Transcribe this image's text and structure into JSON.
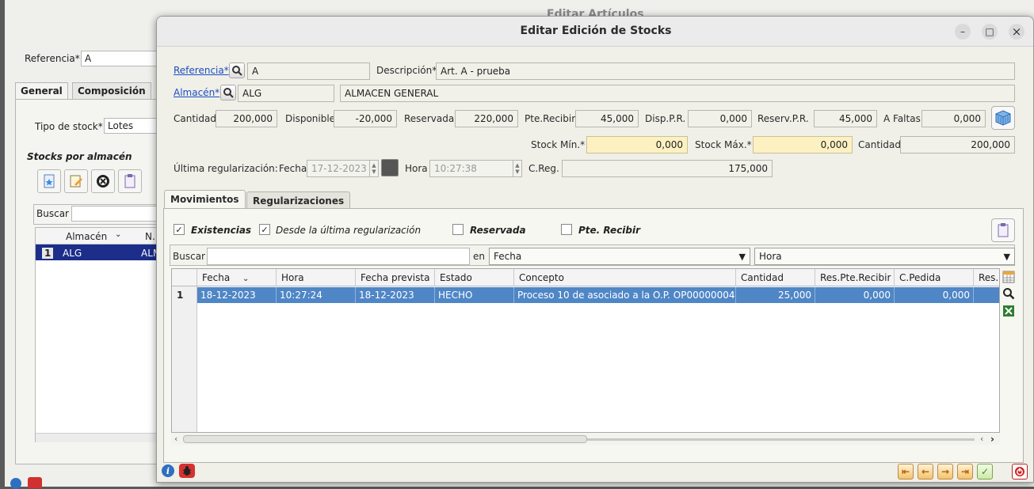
{
  "background_window": {
    "title": "Editar Artículos",
    "referencia_label": "Referencia*",
    "referencia_value": "A",
    "tabs": [
      {
        "label": "General",
        "accel": "G"
      },
      {
        "label": "Composición",
        "accel": "m"
      }
    ],
    "tipo_stock_label": "Tipo de stock*",
    "tipo_stock_value": "Lotes",
    "stocks_section": "Stocks por almacén",
    "buscar_label": "Buscar",
    "grid_headers": [
      "Almacén",
      "N."
    ],
    "grid_row": {
      "num": "1",
      "almacen": "ALG",
      "n": "ALM"
    }
  },
  "dialog": {
    "title": "Editar Edición de Stocks",
    "controls": {
      "minimize": "–",
      "maximize": "□",
      "close": "×"
    },
    "referencia": {
      "label": "Referencia*",
      "value": "A"
    },
    "descripcion": {
      "label": "Descripción*",
      "value": "Art. A - prueba"
    },
    "almacen": {
      "label": "Almacén*",
      "code": "ALG",
      "name": "ALMACEN GENERAL"
    },
    "quantities": {
      "cantidad": {
        "label": "Cantidad",
        "value": "200,000"
      },
      "disponible": {
        "label": "Disponible",
        "value": "-20,000"
      },
      "reservada": {
        "label": "Reservada",
        "value": "220,000"
      },
      "pte_recibir": {
        "label": "Pte.Recibir",
        "value": "45,000"
      },
      "disp_pr": {
        "label": "Disp.P.R.",
        "value": "0,000"
      },
      "reserv_pr": {
        "label": "Reserv.P.R.",
        "value": "45,000"
      },
      "a_faltas": {
        "label": "A Faltas",
        "value": "0,000"
      }
    },
    "stock_min": {
      "label": "Stock Mín.*",
      "value": "0,000"
    },
    "stock_max": {
      "label": "Stock Máx.*",
      "value": "0,000"
    },
    "cantidad2": {
      "label": "Cantidad",
      "value": "200,000"
    },
    "regularizacion": {
      "label": "Última regularización:",
      "fecha_label": "Fecha",
      "fecha_value": "17-12-2023",
      "hora_label": "Hora",
      "hora_value": "10:27:38",
      "creg_label": "C.Reg.",
      "creg_value": "175,000"
    },
    "tabs": [
      {
        "label": "Movimientos",
        "accel": "M",
        "active": true
      },
      {
        "label": "Regularizaciones",
        "accel": "R",
        "active": false
      }
    ],
    "filters": [
      {
        "label": "Existencias",
        "checked": true,
        "bold": true
      },
      {
        "label": "Desde la última regularización",
        "checked": true,
        "bold": false
      },
      {
        "label": "Reservada",
        "checked": false,
        "bold": true
      },
      {
        "label": "Pte. Recibir",
        "checked": false,
        "bold": true
      }
    ],
    "search": {
      "label": "Buscar",
      "value": "",
      "en_label": "en",
      "field1": "Fecha",
      "field2": "Hora"
    },
    "grid": {
      "columns": [
        "Fecha",
        "Hora",
        "Fecha prevista",
        "Estado",
        "Concepto",
        "Cantidad",
        "Res.Pte.Recibir",
        "C.Pedida",
        "Res."
      ],
      "rows": [
        {
          "num": "1",
          "cells": [
            "18-12-2023",
            "10:27:24",
            "18-12-2023",
            "HECHO",
            "Proceso 10 de asociado a la O.P. OP00000004",
            "25,000",
            "0,000",
            "0,000",
            ""
          ]
        }
      ],
      "selected_row_color": "#4f86c6"
    },
    "accent_color": "#1a4fc0",
    "field_yellow": "#fdf1c2"
  }
}
